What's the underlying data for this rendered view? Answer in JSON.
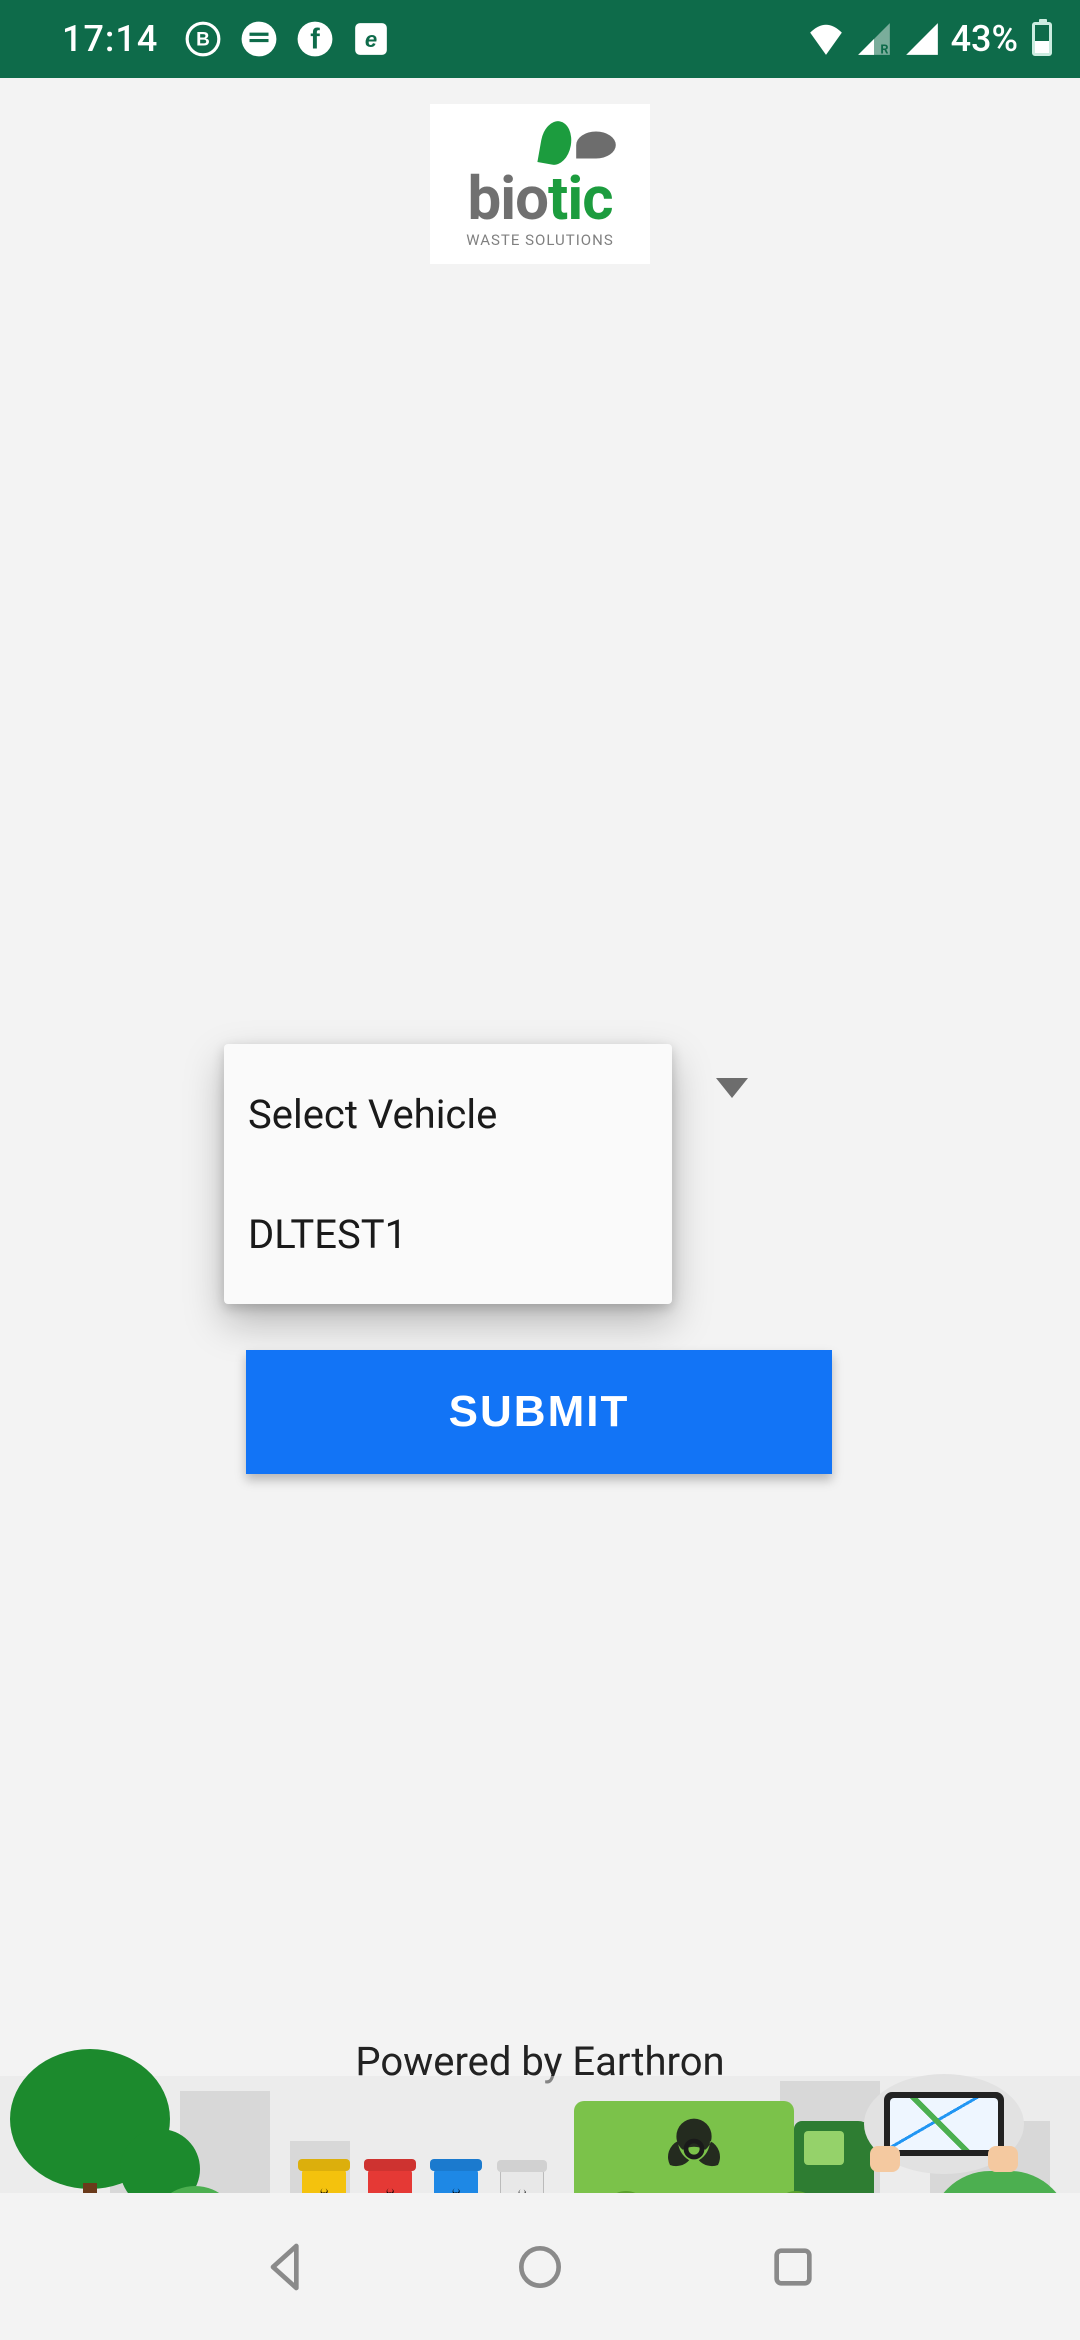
{
  "status_bar": {
    "time": "17:14",
    "battery_text": "43%"
  },
  "logo": {
    "word_part1": "bio",
    "word_part2": "tic",
    "subtitle": "WASTE SOLUTIONS"
  },
  "dropdown": {
    "placeholder": "Select Vehicle",
    "options": [
      "DLTEST1"
    ]
  },
  "buttons": {
    "submit_label": "SUBMIT"
  },
  "footer": {
    "powered_by": "Powered by Earthron"
  },
  "colors": {
    "status_bar_bg": "#0e6b4a",
    "primary_button": "#1274f6",
    "brand_green": "#1c9c3e"
  }
}
